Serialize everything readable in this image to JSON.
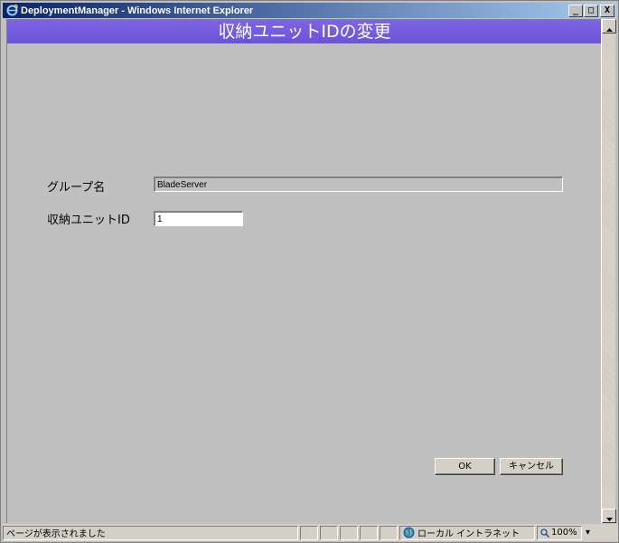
{
  "window": {
    "title": "DeploymentManager - Windows Internet Explorer",
    "minimize_glyph": "_",
    "maximize_glyph": "□",
    "close_glyph": "X"
  },
  "page": {
    "header": "収納ユニットIDの変更"
  },
  "form": {
    "group_name": {
      "label": "グループ名",
      "value": "BladeServer"
    },
    "unit_id": {
      "label": "収納ユニットID",
      "value": "1"
    }
  },
  "buttons": {
    "ok": "OK",
    "cancel": "キャンセル"
  },
  "status": {
    "message": "ページが表示されました",
    "zone": "ローカル イントラネット",
    "zoom": "100%",
    "zoom_dropdown": "▾"
  },
  "colors": {
    "header_bg": "#6f5ae0",
    "titlebar_start": "#0a246a",
    "titlebar_end": "#a6caf0"
  },
  "icons": {
    "app": "ie-icon",
    "zone": "globe-icon",
    "zoom": "magnifier-icon"
  }
}
